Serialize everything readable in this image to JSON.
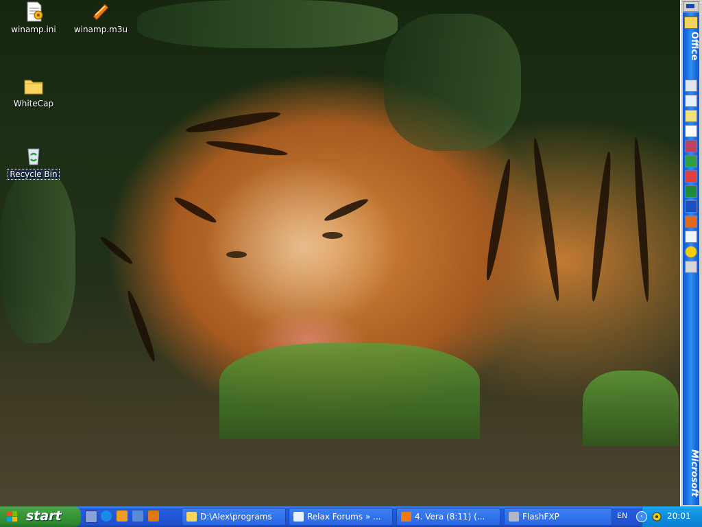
{
  "desktop": {
    "icons": [
      {
        "label": "winamp.ini",
        "icon": "ini-file-icon"
      },
      {
        "label": "winamp.m3u",
        "icon": "winamp-playlist-icon"
      },
      {
        "label": "WhiteCap",
        "icon": "folder-icon"
      },
      {
        "label": "Recycle Bin",
        "icon": "recycle-bin-icon"
      }
    ]
  },
  "officebar": {
    "title": "Office",
    "brand": "Microsoft",
    "colors": {
      "bar": "#1f6fe0"
    }
  },
  "taskbar": {
    "start_label": "start",
    "tasks": [
      {
        "label": "D:\\Alex\\programs",
        "icon": "folder-icon"
      },
      {
        "label": "Relax Forums » ...",
        "icon": "ie-page-icon"
      },
      {
        "label": "4. Vera (8:11) (...",
        "icon": "winamp-icon"
      },
      {
        "label": "FlashFXP",
        "icon": "flashfxp-icon"
      }
    ],
    "language": "EN",
    "clock": "20:01"
  }
}
